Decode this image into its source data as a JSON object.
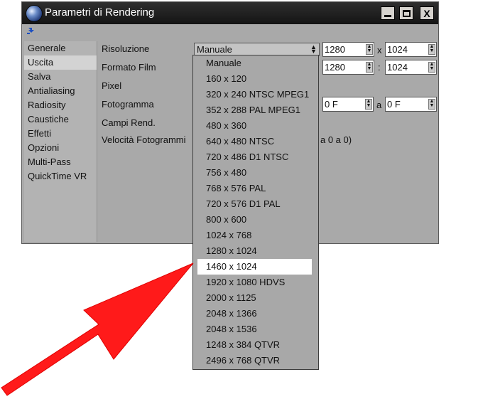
{
  "window": {
    "title": "Parametri di Rendering",
    "buttons": {
      "minimize": "_",
      "maximize": "□",
      "close": "X"
    }
  },
  "sidebar": {
    "items": [
      {
        "label": "Generale"
      },
      {
        "label": "Uscita"
      },
      {
        "label": "Salva"
      },
      {
        "label": "Antialiasing"
      },
      {
        "label": "Radiosity"
      },
      {
        "label": "Caustiche"
      },
      {
        "label": "Effetti"
      },
      {
        "label": "Opzioni"
      },
      {
        "label": "Multi-Pass"
      },
      {
        "label": "QuickTime VR"
      }
    ],
    "active": "Uscita"
  },
  "form": {
    "risoluzione_label": "Risoluzione",
    "formato_film_label": "Formato Film",
    "pixel_label": "Pixel",
    "fotogramma_label": "Fotogramma",
    "campi_rend_label": "Campi Rend.",
    "velocita_label": "Velocità Fotogrammi",
    "risoluzione_value": "Manuale",
    "width_value": "1280",
    "height_value": "1024",
    "sep_x": "x",
    "film_w_value": "1280",
    "film_h_value": "1024",
    "sep_colon": ":",
    "frame_from_value": "0 F",
    "frame_to_value": "0 F",
    "sep_a": "a",
    "frame_hint": "a 0 a 0)"
  },
  "dropdown": {
    "options": [
      "Manuale",
      "160 x 120",
      "320 x 240 NTSC MPEG1",
      "352 x 288 PAL MPEG1",
      "480 x 360",
      "640 x 480 NTSC",
      "720 x 486 D1 NTSC",
      "756 x 480",
      "768 x 576 PAL",
      "720 x 576 D1 PAL",
      "800 x 600",
      "1024 x 768",
      "1280 x 1024",
      "1460 x 1024",
      "1920 x 1080 HDVS",
      "2000 x 1125",
      "2048 x 1366",
      "2048 x 1536",
      "1248 x 384 QTVR",
      "2496 x 768 QTVR"
    ],
    "highlighted": "1460 x 1024"
  },
  "colors": {
    "window_bg": "#a9a9a9",
    "titlebar": "#1a1a1a",
    "highlight": "#ffffff",
    "annotation_arrow": "#ff1a1a"
  },
  "icons": {
    "app": "cinema4d-sphere-icon",
    "pin": "pin-icon",
    "spinner": "spinner-arrows-icon"
  }
}
